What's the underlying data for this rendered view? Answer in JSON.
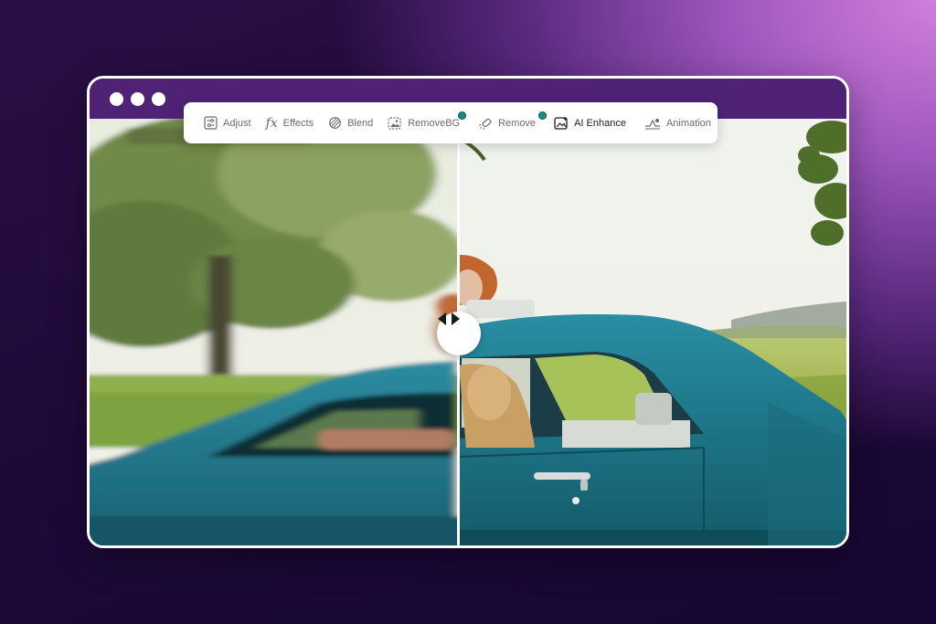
{
  "window": {
    "controls": [
      "dot-1",
      "dot-2",
      "dot-3"
    ]
  },
  "toolbar": {
    "items": [
      {
        "label": "Adjust",
        "icon": "sliders-icon",
        "badge": false,
        "active": false
      },
      {
        "label": "Effects",
        "icon": "fx-icon",
        "badge": false,
        "active": false
      },
      {
        "label": "Blend",
        "icon": "blend-icon",
        "badge": false,
        "active": false
      },
      {
        "label": "RemoveBG",
        "icon": "remove-bg-icon",
        "badge": true,
        "active": false
      },
      {
        "label": "Remove",
        "icon": "eraser-wand-icon",
        "badge": true,
        "active": false
      },
      {
        "label": "AI Enhance",
        "icon": "ai-enhance-image-icon",
        "badge": false,
        "active": true
      },
      {
        "label": "Animation",
        "icon": "animation-icon",
        "badge": false,
        "active": false
      }
    ]
  },
  "comparison": {
    "left_state": "blurred-original",
    "right_state": "ai-enhanced",
    "handle_icon": "left-right-arrows-icon",
    "split_fraction": 0.49
  },
  "colors": {
    "frame_bg": "#4f2276",
    "badge": "#1a8c82",
    "car": "#1f7c90",
    "sky": "#eef0ea"
  }
}
